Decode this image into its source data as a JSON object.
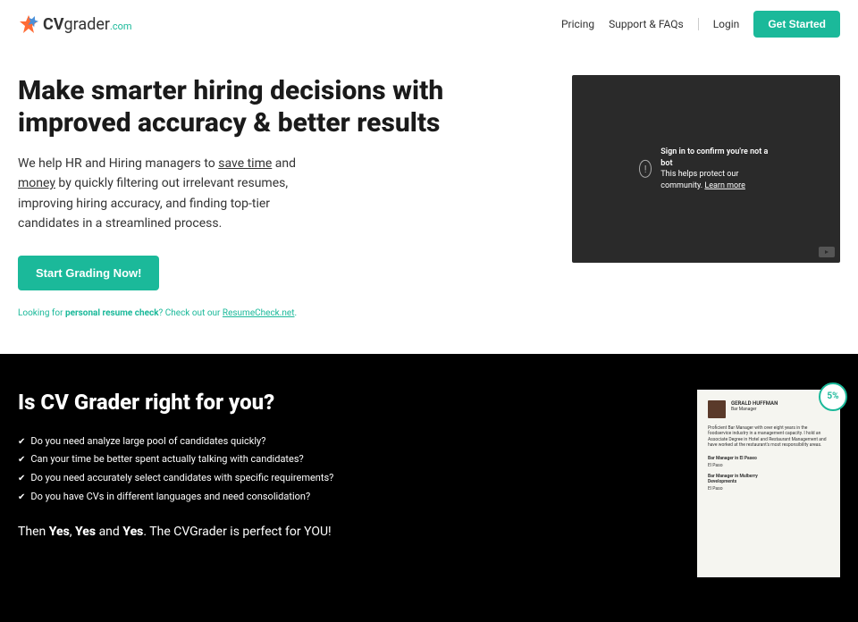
{
  "header": {
    "logo_cv": "CV",
    "logo_grader": "grader",
    "logo_com": ".com",
    "nav": {
      "pricing": "Pricing",
      "support": "Support & FAQs",
      "login": "Login",
      "get_started": "Get Started"
    }
  },
  "hero": {
    "title": "Make smarter hiring decisions with improved accuracy & better results",
    "desc_1": "We help HR and Hiring managers to ",
    "desc_u1": "save time",
    "desc_2": " and ",
    "desc_u2": "money",
    "desc_3": " by quickly filtering out irrelevant resumes, improving hiring accuracy, and finding top-tier candidates in a streamlined process.",
    "cta": "Start Grading Now!",
    "sub_1": "Looking for ",
    "sub_bold": "personal resume check",
    "sub_2": "? Check out our ",
    "sub_link": "ResumeCheck.net",
    "sub_3": "."
  },
  "video": {
    "info_char": "!",
    "line1": "Sign in to confirm you're not a bot",
    "line2a": "This helps protect our community. ",
    "line2b": "Learn more"
  },
  "dark": {
    "title": "Is CV Grader right for you?",
    "items": [
      "Do you need analyze large pool of candidates quickly?",
      "Can your time be better spent actually talking with candidates?",
      "Do you need accurately select candidates with specific requirements?",
      "Do you have CVs in different languages and need consolidation?"
    ],
    "conclusion_1": "Then ",
    "conclusion_yes": "Yes",
    "conclusion_comma": ", ",
    "conclusion_and": " and ",
    "conclusion_2": ". The CVGrader is perfect for YOU!",
    "score": "5%"
  },
  "resume": {
    "name": "GERALD HUFFMAN",
    "sub": "Bar Manager",
    "para": "Proficient Bar Manager with over eight years in the foodservice industry in a management capacity. I hold an Associate Degree in Hotel and Restaurant Management and have worked at the restaurant's most responsibility areas.",
    "job1": "Bar Manager in El Paseo",
    "job2": "Bar Manager in Mulberry Developments",
    "loc": "El Paso"
  }
}
